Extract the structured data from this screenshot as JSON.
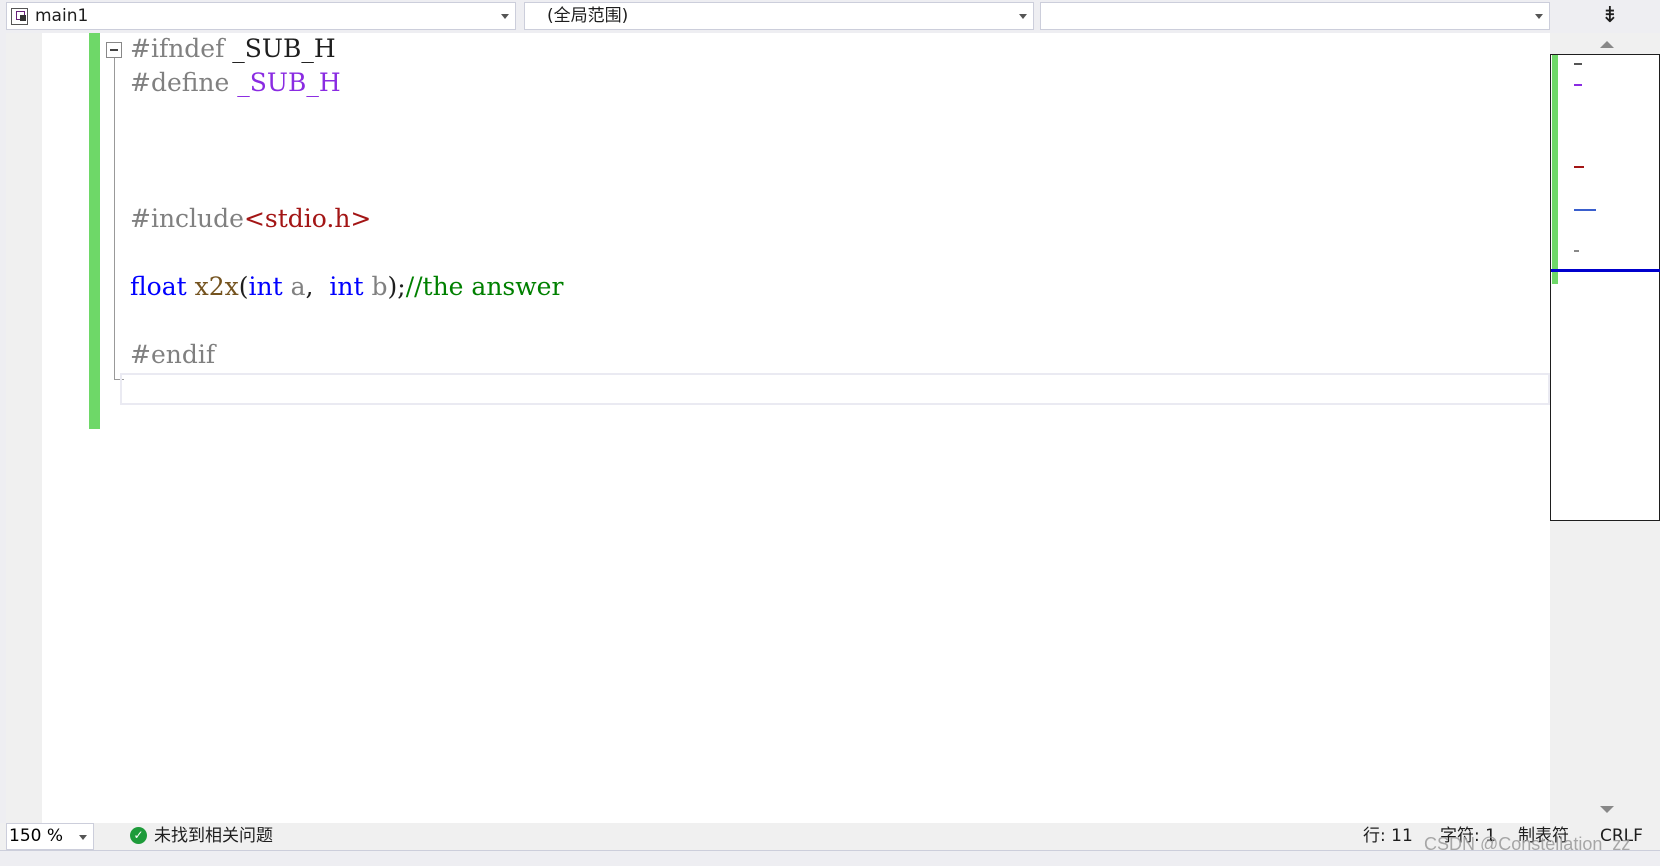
{
  "navbar": {
    "file_dropdown": "main1",
    "scope_dropdown": "(全局范围)",
    "member_dropdown": "",
    "split_icon": "⇟"
  },
  "code_lines": [
    {
      "tokens": [
        {
          "t": "#ifndef ",
          "c": "dir"
        },
        {
          "t": "_SUB_H",
          "c": "plain"
        }
      ]
    },
    {
      "tokens": [
        {
          "t": "#define ",
          "c": "dir"
        },
        {
          "t": "_SUB_H",
          "c": "macro"
        }
      ]
    },
    {
      "tokens": [
        {
          "t": "#include",
          "c": "dir"
        },
        {
          "t": "<stdio.h>",
          "c": "str"
        }
      ]
    },
    {
      "tokens": [
        {
          "t": "float",
          "c": "type"
        },
        {
          "t": " ",
          "c": "plain"
        },
        {
          "t": "x2x",
          "c": "func"
        },
        {
          "t": "(",
          "c": "plain"
        },
        {
          "t": "int",
          "c": "type"
        },
        {
          "t": " ",
          "c": "plain"
        },
        {
          "t": "a",
          "c": "param"
        },
        {
          "t": ",  ",
          "c": "plain"
        },
        {
          "t": "int",
          "c": "type"
        },
        {
          "t": " ",
          "c": "plain"
        },
        {
          "t": "b",
          "c": "param"
        },
        {
          "t": ");",
          "c": "plain"
        },
        {
          "t": "//the answer",
          "c": "comment"
        }
      ]
    },
    {
      "tokens": [
        {
          "t": "#endif",
          "c": "dir"
        }
      ]
    }
  ],
  "statusbar": {
    "zoom": "150 %",
    "issues": "未找到相关问题",
    "line": "行: 11",
    "char": "字符: 1",
    "tabs": "制表符",
    "eol": "CRLF"
  },
  "watermark": "CSDN @Constellation_zz",
  "colors": {
    "change_bar": "#6ed868",
    "keyword": "#0000ff",
    "comment": "#008000",
    "string": "#a31515",
    "macro": "#8a2be2",
    "preprocessor": "#808080"
  }
}
